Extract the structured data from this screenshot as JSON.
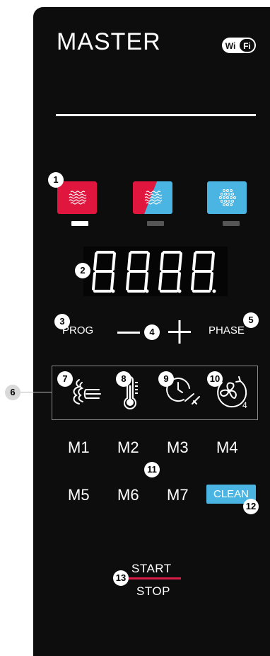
{
  "header": {
    "title": "MASTER",
    "wifi_label": "WiFi"
  },
  "mode_buttons": [
    {
      "name": "steam",
      "color": "#e0163f",
      "active": true
    },
    {
      "name": "combi",
      "color": "#e0163f",
      "accent": "#4ab5e2",
      "active": false
    },
    {
      "name": "convection",
      "color": "#4ab5e2",
      "active": false
    }
  ],
  "display": {
    "digits": "8.8.8.8."
  },
  "controls": {
    "prog": "PROG",
    "phase": "PHASE",
    "minus": "—",
    "plus": "+"
  },
  "fan_speed": "4",
  "memory_row1": [
    "M1",
    "M2",
    "M3",
    "M4"
  ],
  "memory_row2": [
    "M5",
    "M6",
    "M7"
  ],
  "clean": "CLEAN",
  "start": "START",
  "stop": "STOP",
  "callouts": [
    "1",
    "2",
    "3",
    "4",
    "5",
    "6",
    "7",
    "8",
    "9",
    "10",
    "11",
    "12",
    "13"
  ],
  "colors": {
    "red": "#e0163f",
    "blue": "#4ab5e2",
    "panel": "#0d0d0d"
  }
}
